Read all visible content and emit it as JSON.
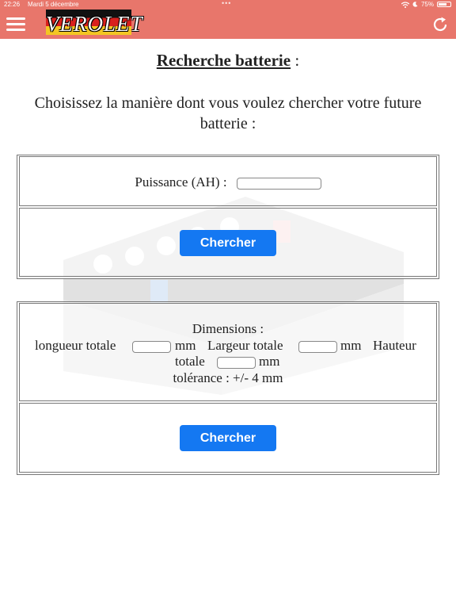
{
  "status_bar": {
    "time": "22:26",
    "date": "Mardi 5 décembre",
    "battery": "75%"
  },
  "header": {
    "logo_text": "VEROLET",
    "menu_icon": "hamburger-icon",
    "refresh_icon": "refresh-icon"
  },
  "page": {
    "title": "Recherche batterie",
    "title_suffix": " :",
    "subtitle": "Choisissez la manière dont vous voulez chercher votre future batterie :"
  },
  "power_search": {
    "label": "Puissance (AH) :",
    "value": "",
    "button_label": "Chercher"
  },
  "dimension_search": {
    "heading": "Dimensions :",
    "length_label": "longueur totale",
    "width_label": "Largeur totale",
    "height_label_1": "Hauteur",
    "height_label_2": "totale",
    "unit": "mm",
    "tolerance": "tolérance : +/- 4 mm",
    "length_value": "",
    "width_value": "",
    "height_value": "",
    "button_label": "Chercher"
  },
  "colors": {
    "header": "#e8766b",
    "button": "#1478f2"
  }
}
